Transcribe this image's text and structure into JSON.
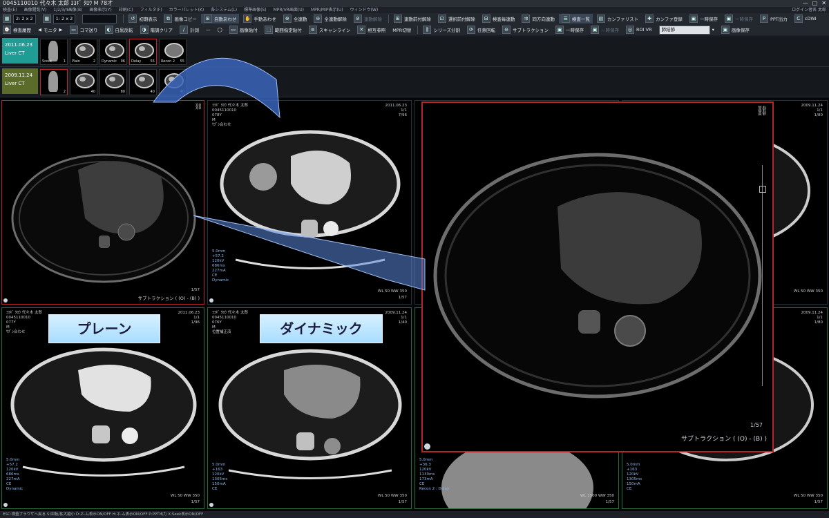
{
  "window": {
    "title": "0045110010 代々木 太郎 ﾖﾖｷﾞ ﾀﾛｳ M 78才",
    "controls": [
      "—",
      "□",
      "✕"
    ]
  },
  "menu": {
    "items": [
      "検査(E)",
      "画像閲覧(V)",
      "1/2/3/4画像(B)",
      "画像表示(Y)",
      "印刷(C)",
      "フィルタ(F)",
      "カラーパレット(K)",
      "各システム(L)",
      "標準画像(S)",
      "MPR/VR画面(U)",
      "MPR/MIP表示(U)",
      "ウィンドウ(W)"
    ],
    "right": "ログイン者名 太郎"
  },
  "toolbar1": {
    "layout1": "2: 2 x 2",
    "layout2": "1: 2 x 2",
    "buttons": [
      "初期表示",
      "画像コピー",
      "自動あわせ",
      "手動あわせ",
      "全連動",
      "全連動解除",
      "連動解除",
      "連動前付解除",
      "選択前付解除",
      "検査毎連動",
      "同方向連動",
      "検査一覧",
      "カンファリスト",
      "カンファ登録",
      "一時保存",
      "一時保存",
      "PPT出力",
      "cDWI"
    ]
  },
  "toolbar2": {
    "buttons": [
      "検査履歴",
      "モニタ",
      "コマ送り",
      "白黒反転",
      "階調クリア",
      "計測",
      "画像貼付",
      "範囲指定貼付",
      "スキャンライン",
      "相互参照",
      "MPR切替",
      "シリーズ分割",
      "任意回転",
      "サブトラクション",
      "一時保存",
      "一時保存",
      "ROI VR",
      "画像保存"
    ],
    "select_value": "肺結節"
  },
  "history": [
    {
      "date": "2011.06.23",
      "study": "Liver CT",
      "color": "#1f9c93",
      "thumbs": [
        {
          "label": "Scout",
          "num": "1"
        },
        {
          "label": "Plain",
          "num": "2"
        },
        {
          "label": "Dynamic",
          "num": "96"
        },
        {
          "label": "Delay",
          "num": "55"
        },
        {
          "label": "Recon 2",
          "num": "55"
        }
      ]
    },
    {
      "date": "2009.11.24",
      "study": "Liver CT",
      "color": "#5a6b2a",
      "thumbs": [
        {
          "label": "",
          "num": "2"
        },
        {
          "label": "",
          "num": "40"
        },
        {
          "label": "",
          "num": "80"
        },
        {
          "label": "",
          "num": "40"
        },
        {
          "label": "",
          "num": "40"
        }
      ]
    }
  ],
  "viewports": {
    "v1": {
      "caption": "サブトラクション ( (O) - (B) )",
      "num": "1/57"
    },
    "v2": {
      "tl": "ﾖﾖｷﾞ ﾀﾛｳ 代々木 太郎\n0045110010\n078Y\nM\nｻｸﾞｼ合わせ",
      "tr": "2011.06.23\n1/1\n7/96",
      "bl": "5.0mm\n+57.2\n120kV\n686ms\n227mA\nCE\nDynamic",
      "wl": "WL 50 WW 350",
      "num": "1/57"
    },
    "v3": {
      "tl": "ﾖﾖｷﾞ ﾀﾛｳ 代々木 太郎\n0045110010\n077Y\nM\nｻｸﾞｼ合わせ",
      "tr": "2011.06.23\n1/1\n1/96",
      "bl": "5.0mm\n+57.2\n120kV\n686ms\n227mA\nCE\nDynamic",
      "wl": "WL 50 WW 350",
      "num": "1/57",
      "label": "プレーン"
    },
    "v4": {
      "tl": "ﾖﾖｷﾞ ﾀﾛｳ 代々木 太郎\n0045110010\n076Y\nM\n位置補正済",
      "tr": "2009.11.24\n1/1\n1/40",
      "bl": "5.0mm\n+163\n120kV\n1305ms\n150mA\nCE",
      "wl": "WL 50 WW 350",
      "num": "1/57",
      "label": "ダイナミック"
    },
    "v5": {
      "caption": "サブトラクション ( (O) - (B) )",
      "num": "1/57"
    },
    "v6": {
      "tr": "2009.11.24\n1/1\n1/80",
      "wl": "WL 50 WW 350"
    },
    "v7": {
      "bl": "5.0mm\n+36.3\n120kV\n1130ms\n173mA\nCE\nRecon 2 : Delay",
      "wl": "WL 1500 WW 350",
      "num": "1/57"
    },
    "v8": {
      "tr": "2009.11.24\n1/1\n1/80",
      "bl": "5.0mm\n+163\n120kV\n1305ms\n150mA\nCE",
      "wl": "WL 50 WW 350",
      "num": "1/57"
    }
  },
  "statusbar": "ESC:検査ブラウザへ戻る  S:回転/拡大縮小  D:ネ-ム表示ON/OFF  H:ネ-ム表示ON/OFF  P:PPT出力  X:Seek表示ON/OFF"
}
